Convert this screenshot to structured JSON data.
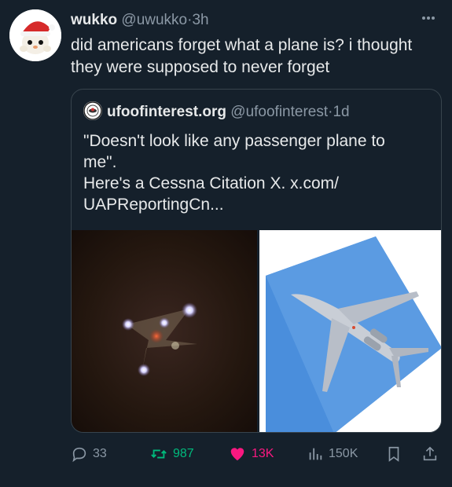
{
  "tweet": {
    "author_name": "wukko",
    "handle": "@uwukko",
    "time": "3h",
    "text": "did americans forget what a plane is? i thought they were supposed to never forget"
  },
  "quoted": {
    "author_name": "ufoofinterest.org",
    "handle": "@ufoofinterest",
    "time": "1d",
    "text_lines": [
      "\"Doesn't look like any passenger plane to",
      "me\".",
      "Here's a Cessna Citation X.",
      "UAPReportingCn..."
    ],
    "link_text": "x.com/"
  },
  "actions": {
    "replies": "33",
    "reposts": "987",
    "likes": "13K",
    "views": "150K"
  },
  "colors": {
    "background": "#15202b",
    "text": "#e7e9ea",
    "muted": "#8b98a5",
    "repost": "#00ba7c",
    "like": "#f91880",
    "border": "#38444d"
  },
  "icons": [
    "more-icon",
    "reply-icon",
    "repost-icon",
    "like-icon",
    "views-icon",
    "bookmark-icon",
    "share-icon"
  ]
}
